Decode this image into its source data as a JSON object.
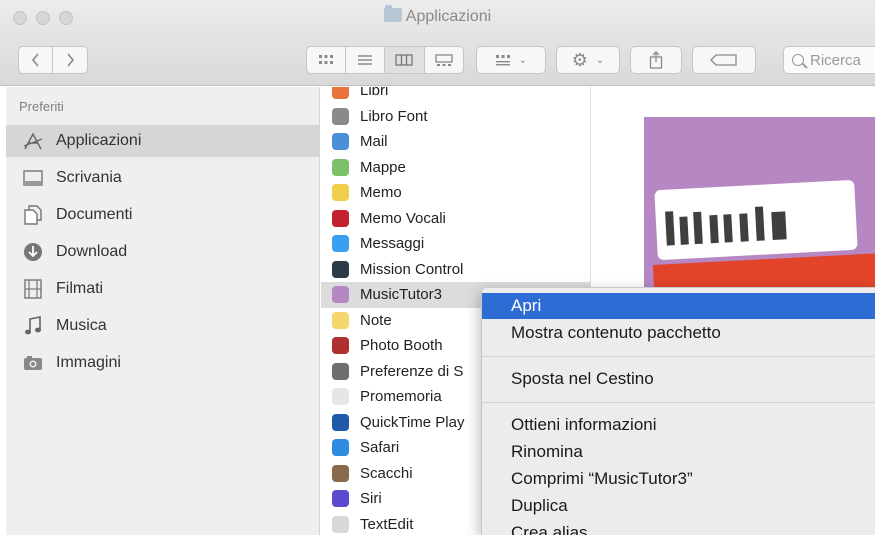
{
  "window": {
    "title": "Applicazioni"
  },
  "toolbar": {
    "search_placeholder": "Ricerca",
    "icons": [
      "back-icon",
      "forward-icon",
      "icon-view-icon",
      "list-view-icon",
      "column-view-icon",
      "gallery-view-icon",
      "group-icon",
      "gear-icon",
      "share-icon",
      "tag-icon",
      "search-icon"
    ]
  },
  "sidebar": {
    "section_title": "Preferiti",
    "items": [
      {
        "label": "Applicazioni",
        "icon": "applications-icon",
        "selected": true
      },
      {
        "label": "Scrivania",
        "icon": "desktop-icon",
        "selected": false
      },
      {
        "label": "Documenti",
        "icon": "documents-icon",
        "selected": false
      },
      {
        "label": "Download",
        "icon": "download-icon",
        "selected": false
      },
      {
        "label": "Filmati",
        "icon": "movies-icon",
        "selected": false
      },
      {
        "label": "Musica",
        "icon": "music-icon",
        "selected": false
      },
      {
        "label": "Immagini",
        "icon": "pictures-icon",
        "selected": false
      }
    ]
  },
  "files": [
    {
      "name": "Libri",
      "color": "#e8743b"
    },
    {
      "name": "Libro Font",
      "color": "#8a8a8a"
    },
    {
      "name": "Mail",
      "color": "#4a8fd8"
    },
    {
      "name": "Mappe",
      "color": "#7cc06a"
    },
    {
      "name": "Memo",
      "color": "#f2cf4a"
    },
    {
      "name": "Memo Vocali",
      "color": "#c2202c"
    },
    {
      "name": "Messaggi",
      "color": "#3b9ff0"
    },
    {
      "name": "Mission Control",
      "color": "#2d3a4a"
    },
    {
      "name": "MusicTutor3",
      "color": "#b687c2",
      "selected": true
    },
    {
      "name": "Note",
      "color": "#f5d76e"
    },
    {
      "name": "Photo Booth",
      "color": "#b03030"
    },
    {
      "name": "Preferenze di S",
      "color": "#6f6f6f"
    },
    {
      "name": "Promemoria",
      "color": "#e6e6e6"
    },
    {
      "name": "QuickTime Play",
      "color": "#1f5aa8"
    },
    {
      "name": "Safari",
      "color": "#2f8ce0"
    },
    {
      "name": "Scacchi",
      "color": "#8a6a4a"
    },
    {
      "name": "Siri",
      "color": "#5a4ad0"
    },
    {
      "name": "TextEdit",
      "color": "#d8d8d8"
    }
  ],
  "context_menu": {
    "items": [
      {
        "label": "Apri",
        "active": true
      },
      {
        "label": "Mostra contenuto pacchetto"
      },
      {
        "separator": true
      },
      {
        "label": "Sposta nel Cestino"
      },
      {
        "separator": true
      },
      {
        "label": "Ottieni informazioni"
      },
      {
        "label": "Rinomina"
      },
      {
        "label": "Comprimi “MusicTutor3”"
      },
      {
        "label": "Duplica"
      },
      {
        "label": "Crea alias"
      }
    ]
  },
  "colors": {
    "menu_highlight": "#2d6cd4",
    "sidebar_bg": "#efefef",
    "selection_bg": "#dcdcdc"
  }
}
